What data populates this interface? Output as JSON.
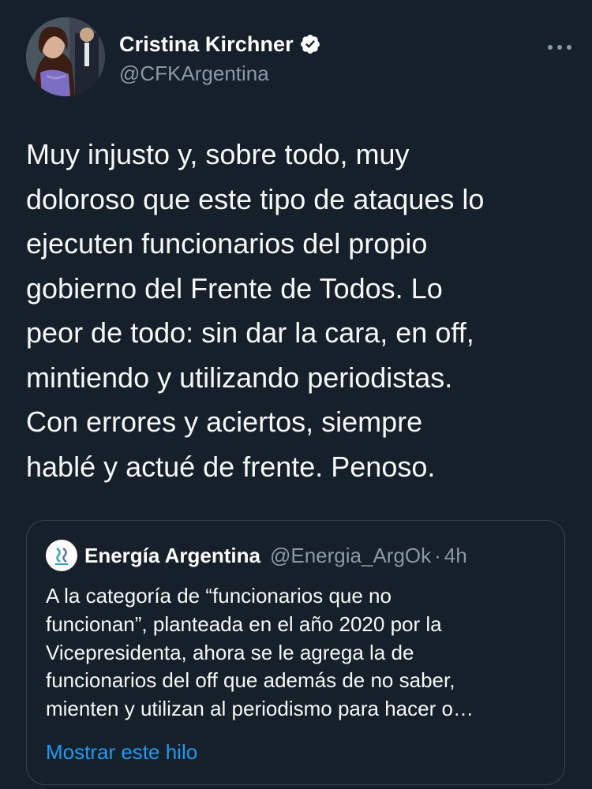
{
  "author": {
    "display_name": "Cristina Kirchner",
    "handle": "@CFKArgentina",
    "verified": true,
    "avatar_icon": "profile-photo"
  },
  "tweet": {
    "text": "Muy injusto y, sobre todo, muy\ndoloroso que este tipo de ataques lo\nejecuten funcionarios del propio\ngobierno del Frente de Todos. Lo\npeor de todo: sin dar la cara, en off,\nmintiendo y utilizando periodistas.\nCon errores y aciertos, siempre\nhablé y actué de frente. Penoso."
  },
  "quoted_tweet": {
    "display_name": "Energía Argentina",
    "handle": "@Energia_ArgOk",
    "separator": "·",
    "time": "4h",
    "avatar_icon": "energia-argentina-logo",
    "text": "A la categoría de “funcionarios que no\nfuncionan”, planteada en el año 2020 por la\nVicepresidenta, ahora se le agrega la de\nfuncionarios del off que además de no saber,\nmienten y utilizan al periodismo para hacer o…",
    "show_thread_label": "Mostrar este hilo"
  },
  "colors": {
    "background": "#15202b",
    "text_primary": "#f7f9f9",
    "text_secondary": "#8b98a5",
    "border": "#38444d",
    "link": "#1d9bf0"
  }
}
